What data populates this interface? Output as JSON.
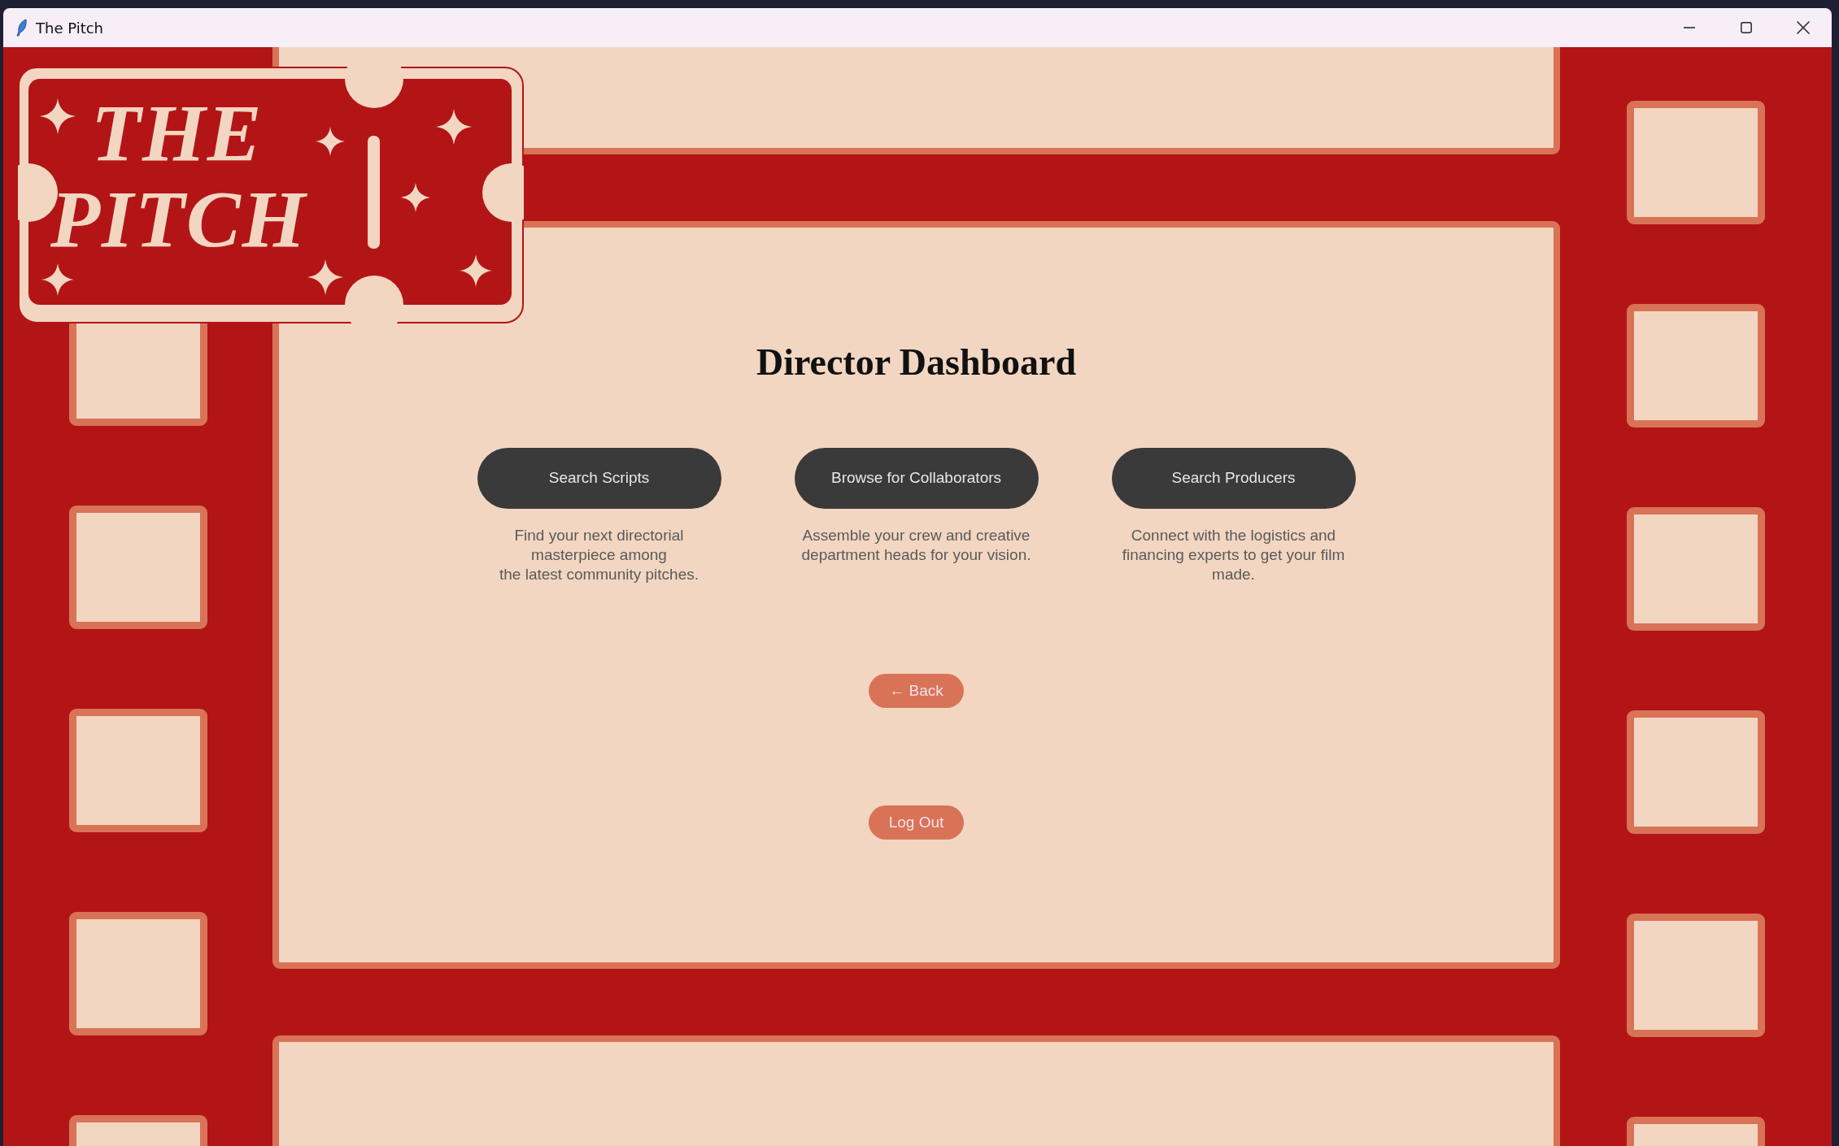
{
  "window": {
    "title": "The Pitch"
  },
  "logo": {
    "lines": [
      "THE",
      "PITCH"
    ]
  },
  "heading": "Director Dashboard",
  "actions": [
    {
      "label": "Search Scripts",
      "description": "Find your next directorial masterpiece among\nthe latest community pitches."
    },
    {
      "label": "Browse for Collaborators",
      "description": "Assemble your crew and creative department heads for your vision."
    },
    {
      "label": "Search Producers",
      "description": "Connect with the logistics and financing experts to get your film made."
    }
  ],
  "nav_buttons": [
    {
      "label": "← Back"
    },
    {
      "label": "Log Out"
    }
  ]
}
